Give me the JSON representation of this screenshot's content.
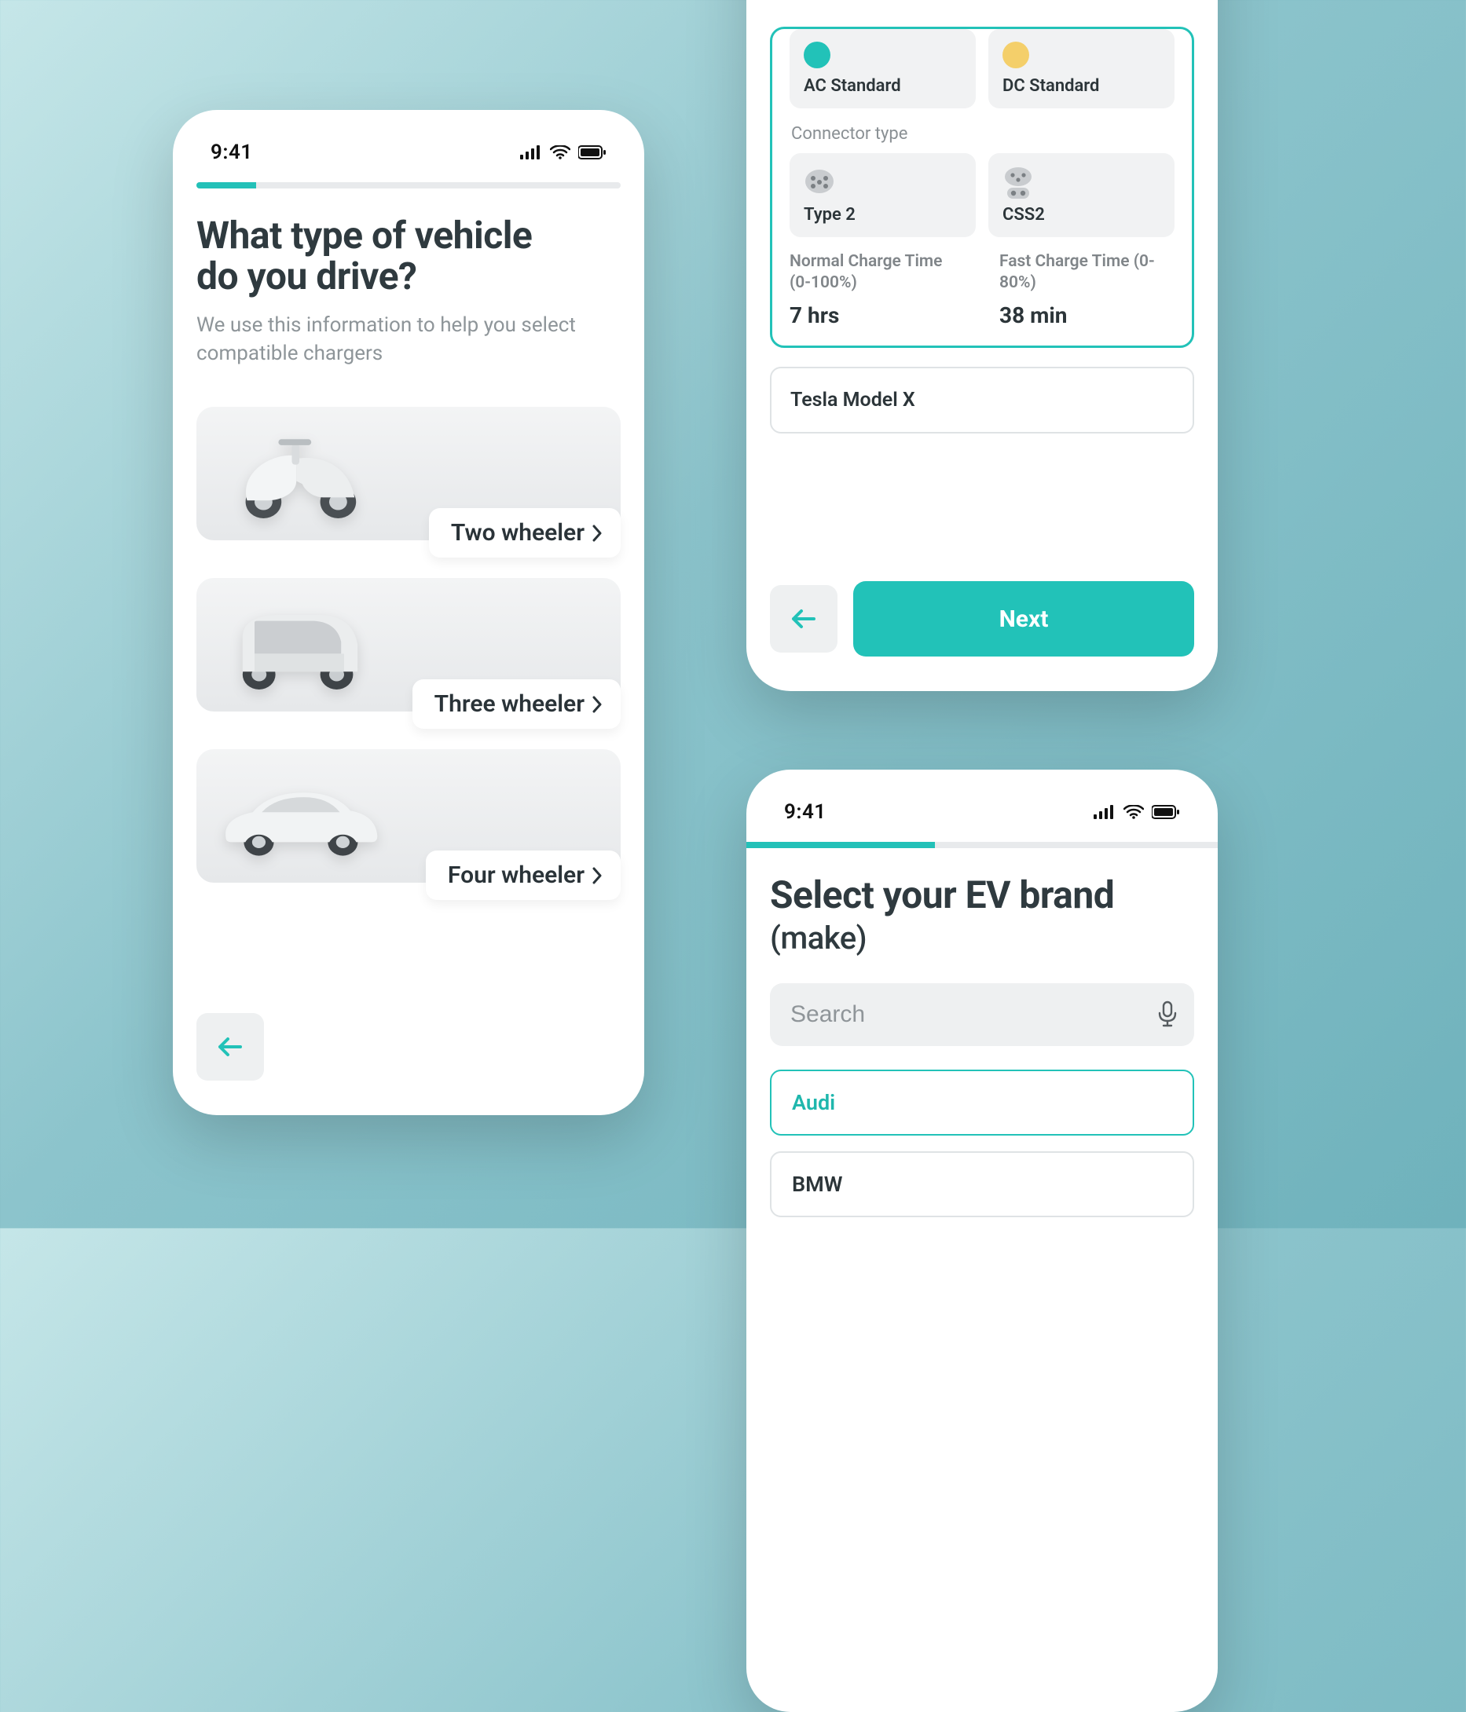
{
  "status": {
    "time": "9:41"
  },
  "colors": {
    "accent": "#22c2b8"
  },
  "screen1": {
    "progress_pct": 14,
    "title_line1": "What type of vehicle",
    "title_line2": "do you drive?",
    "subtitle": "We use this information to help you select compatible chargers",
    "options": [
      {
        "label": "Two wheeler"
      },
      {
        "label": "Three wheeler"
      },
      {
        "label": "Four wheeler"
      }
    ]
  },
  "screen2": {
    "charger_types": [
      {
        "label": "AC Standard"
      },
      {
        "label": "DC Standard"
      }
    ],
    "connector_heading": "Connector type",
    "connectors": [
      {
        "label": "Type 2"
      },
      {
        "label": "CSS2"
      }
    ],
    "normal_label": "Normal Charge Time (0-100%)",
    "normal_value": "7 hrs",
    "fast_label": "Fast Charge Time (0-80%)",
    "fast_value": "38 min",
    "other_option": "Tesla Model X",
    "next_label": "Next"
  },
  "screen3": {
    "progress_pct": 40,
    "title_main": "Select your EV brand",
    "title_paren": "(make)",
    "search_placeholder": "Search",
    "brands": [
      {
        "name": "Audi",
        "selected": true
      },
      {
        "name": "BMW",
        "selected": false
      }
    ]
  }
}
